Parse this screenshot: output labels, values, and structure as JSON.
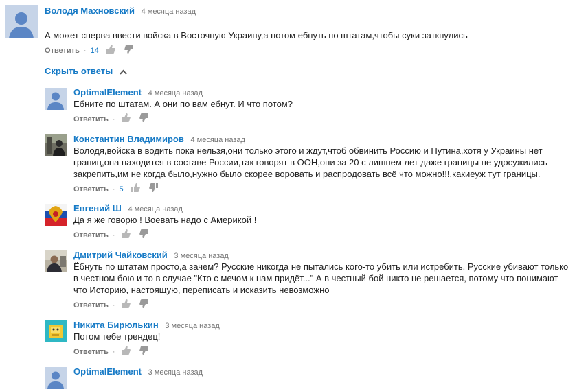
{
  "main_comment": {
    "author": "Володя Махновский",
    "time": "4 месяца назад",
    "text": "А может сперва ввести войска в Восточную Украину,а потом ебнуть по штатам,чтобы суки заткнулись",
    "reply_label": "Ответить",
    "likes": "14"
  },
  "replies_toggle": {
    "label": "Скрыть ответы"
  },
  "replies": [
    {
      "author": "OptimalElement",
      "time": "4 месяца назад",
      "text": "Ебните по штатам. А они по вам ебнут. И что потом?",
      "reply_label": "Ответить",
      "likes": ""
    },
    {
      "author": "Константин Владимиров",
      "time": "4 месяца назад",
      "text": "Володя,войска в водить пока нельзя,они только этого и ждут,чтоб обвинить Россию и Путина,хотя у Украины нет границ,она находится в составе России,так говорят в ООН,они за 20 с лишнем лет даже границы не удосужились закрепить,им не когда было,нужно было скорее воровать и распродовать всё что можно!!!,какиеуж тут границы.",
      "reply_label": "Ответить",
      "likes": "5"
    },
    {
      "author": "Евгений Ш",
      "time": "4 месяца назад",
      "text": "Да я же говорю ! Воевать надо с Америкой !",
      "reply_label": "Ответить",
      "likes": ""
    },
    {
      "author": "Дмитрий Чайковский",
      "time": "3 месяца назад",
      "text": "Ёбнуть по штатам просто,а зачем? Русские никогда не пытались кого-то убить или истребить. Русские убивают только в честном бою и то в случае \"Кто с мечом к нам придёт...\" А в честный бой никто не решается, потому что понимают что Историю, настоящую, переписать и исказить невозможно",
      "reply_label": "Ответить",
      "likes": ""
    },
    {
      "author": "Никита Бирюлькин",
      "time": "3 месяца назад",
      "text": "Потом тебе трендец!",
      "reply_label": "Ответить",
      "likes": ""
    },
    {
      "author": "OptimalElement",
      "time": "3 месяца назад",
      "text": "",
      "reply_label": "",
      "likes": ""
    }
  ],
  "colors": {
    "link": "#167ac6",
    "meta": "#767676",
    "avatar_default_bg": "#c6d4e8",
    "avatar_default_fg": "#5b86c5"
  },
  "icons": {
    "like": "thumb-up-icon",
    "dislike": "thumb-down-icon",
    "toggle": "chevron-up-icon"
  }
}
